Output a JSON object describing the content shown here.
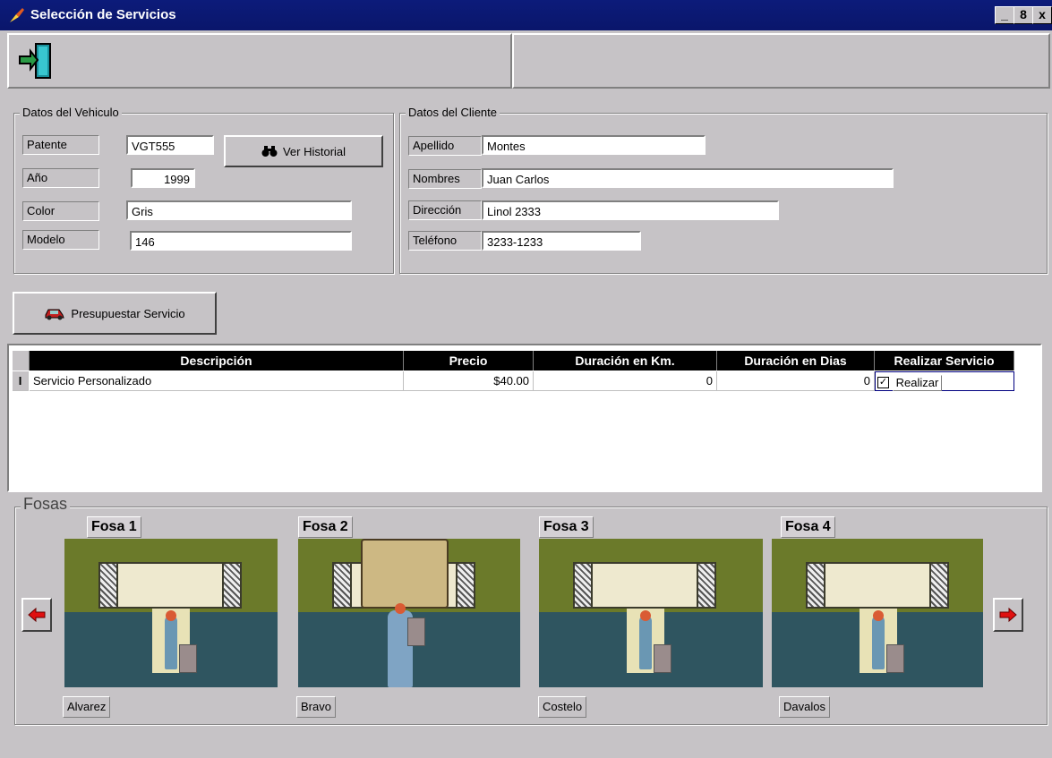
{
  "window": {
    "title": "Selección de Servicios",
    "buttons": [
      "_",
      "8",
      "x"
    ]
  },
  "vehiculo": {
    "group_title": "Datos del Vehiculo",
    "patente_label": "Patente",
    "patente_value": "VGT555",
    "anio_label": "Año",
    "anio_value": "1999",
    "color_label": "Color",
    "color_value": "Gris",
    "modelo_label": "Modelo",
    "modelo_value": "146",
    "historial_button": "Ver Historial"
  },
  "cliente": {
    "group_title": "Datos del Cliente",
    "apellido_label": "Apellido",
    "apellido_value": "Montes",
    "nombres_label": "Nombres",
    "nombres_value": "Juan Carlos",
    "direccion_label": "Dirección",
    "direccion_value": "Linol 2333",
    "telefono_label": "Teléfono",
    "telefono_value": "3233-1233"
  },
  "presupuestar_button": "Presupuestar Servicio",
  "grid": {
    "columns": [
      "Descripción",
      "Precio",
      "Duración en Km.",
      "Duración en Dias",
      "Realizar Servicio"
    ],
    "rows": [
      {
        "marker": "I",
        "descripcion": "Servicio Personalizado",
        "precio": "$40.00",
        "km": "0",
        "dias": "0",
        "realizar": "Realizar",
        "checked": true
      }
    ]
  },
  "fosas": {
    "group_title": "Fosas",
    "items": [
      {
        "name": "Fosa 1",
        "person": "Alvarez",
        "occupied": false
      },
      {
        "name": "Fosa 2",
        "person": "Bravo",
        "occupied": true
      },
      {
        "name": "Fosa 3",
        "person": "Costelo",
        "occupied": false
      },
      {
        "name": "Fosa 4",
        "person": "Davalos",
        "occupied": false
      }
    ]
  },
  "colors": {
    "titlebar": "#0c1b7a",
    "window_bg": "#c6c3c6",
    "grid_header": "#000000",
    "arrow": "#e01010"
  }
}
